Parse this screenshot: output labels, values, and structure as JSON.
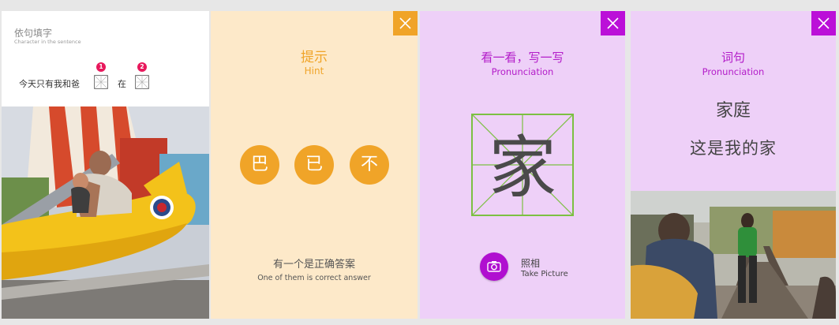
{
  "card1": {
    "title": "依句填字",
    "subtitle": "Character in the sentence",
    "sentence_start": "今天只有我和爸",
    "blank_numbers": [
      "1",
      "2"
    ],
    "middle_word": "在"
  },
  "card2": {
    "title_cn": "提示",
    "title_en": "Hint",
    "options": [
      "巴",
      "已",
      "不"
    ],
    "footer_cn": "有一个是正确答案",
    "footer_en": "One of them is correct answer",
    "close_icon": "close-icon"
  },
  "card3": {
    "title_cn": "看一看，写一写",
    "title_en": "Pronunciation",
    "character": "家",
    "camera_label_cn": "照相",
    "camera_label_en": "Take Picture",
    "close_icon": "close-icon"
  },
  "card4": {
    "title_cn": "词句",
    "title_en": "Pronunciation",
    "word": "家庭",
    "sentence": "这是我的家",
    "close_icon": "close-icon"
  },
  "colors": {
    "hint_orange": "#f0a428",
    "hint_bg": "#fde9c9",
    "purple": "#bb10d8",
    "purple_bg": "#eed0f8",
    "badge_red": "#e8185c",
    "grid_green": "#7cc043"
  }
}
